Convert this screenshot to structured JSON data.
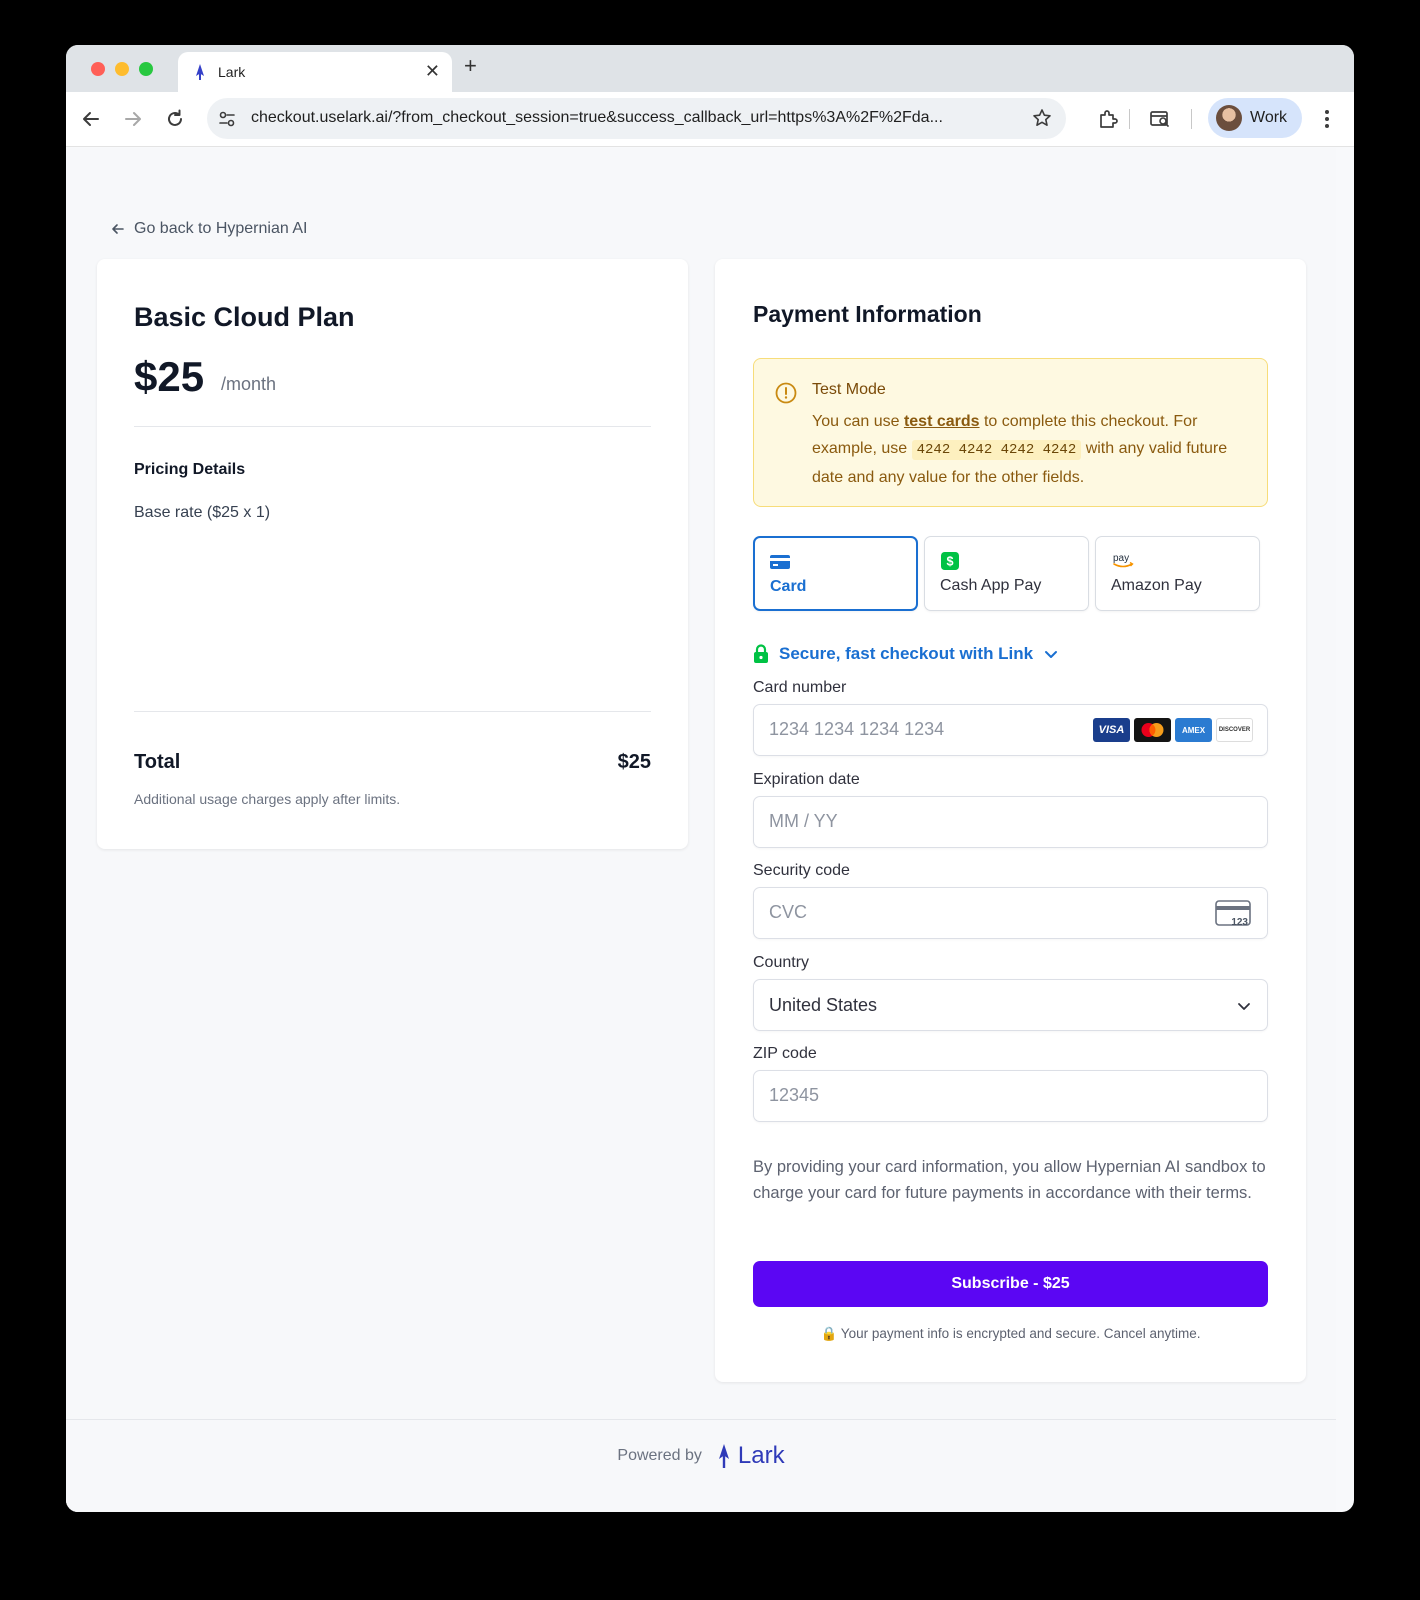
{
  "browser": {
    "tab_title": "Lark",
    "tab_close": "✕",
    "new_tab": "+",
    "url": "checkout.uselark.ai/?from_checkout_session=true&success_callback_url=https%3A%2F%2Fda...",
    "profile_label": "Work"
  },
  "page": {
    "back_link": "Go back to Hypernian AI"
  },
  "plan": {
    "name": "Basic Cloud Plan",
    "price": "$25",
    "period": "/month",
    "pricing_details_title": "Pricing Details",
    "base_rate": "Base rate ($25 x 1)",
    "total_label": "Total",
    "total_value": "$25",
    "total_note": "Additional usage charges apply after limits."
  },
  "payment": {
    "title": "Payment Information",
    "test_mode": {
      "title": "Test Mode",
      "text_1": "You can use ",
      "link": "test cards",
      "text_2": " to complete this checkout. For example, use ",
      "code": "4242 4242 4242 4242",
      "text_3": " with any valid future date and any value for the other fields."
    },
    "methods": [
      {
        "label": "Card",
        "selected": true
      },
      {
        "label": "Cash App Pay",
        "selected": false
      },
      {
        "label": "Amazon Pay",
        "selected": false
      }
    ],
    "amazon_pay_mark": "pay",
    "link_checkout": "Secure, fast checkout with Link",
    "card_number": {
      "label": "Card number",
      "placeholder": "1234 1234 1234 1234"
    },
    "card_brands": [
      "VISA",
      "AMEX",
      "DISCOVER"
    ],
    "expiration": {
      "label": "Expiration date",
      "placeholder": "MM / YY"
    },
    "security_code": {
      "label": "Security code",
      "placeholder": "CVC",
      "icon_text": "123"
    },
    "country": {
      "label": "Country",
      "value": "United States"
    },
    "zip": {
      "label": "ZIP code",
      "placeholder": "12345"
    },
    "consent": "By providing your card information, you allow Hypernian AI sandbox to charge your card for future payments in accordance with their terms.",
    "subscribe_button": "Subscribe - $25",
    "secure_note": "🔒 Your payment info is encrypted and secure. Cancel anytime."
  },
  "footer": {
    "powered_by": "Powered by",
    "brand": "Lark"
  },
  "colors": {
    "accent": "#5b06f3",
    "link_blue": "#1a6fd1",
    "test_mode_bg": "#fef9e1",
    "lark_brand": "#2f3ab8"
  }
}
